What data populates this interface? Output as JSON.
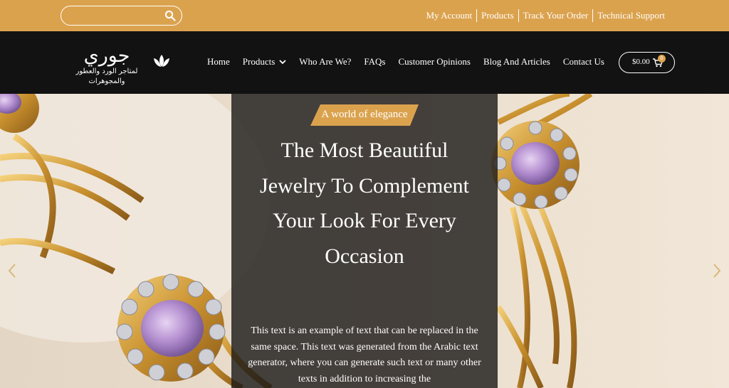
{
  "topbar": {
    "search": {
      "placeholder": "",
      "value": "",
      "icon": "search-icon"
    },
    "links": [
      "My Account",
      "Products",
      "Track Your Order",
      "Technical Support"
    ]
  },
  "header": {
    "logo": {
      "name": "جوري",
      "subtitle": "لمتاجر الورد والعطور والمجوهرات",
      "icon": "lotus-icon"
    },
    "nav": {
      "home": "Home",
      "products": "Products",
      "who": "Who Are We?",
      "faqs": "FAQs",
      "opinions": "Customer Opinions",
      "blog": "Blog And Articles",
      "contact": "Contact Us"
    },
    "cart": {
      "price": "$0.00",
      "count": "0",
      "icon": "basket-icon"
    }
  },
  "hero": {
    "tag": "A world of elegance",
    "headline": "The Most Beautiful Jewelry To Complement Your Look For Every Occasion",
    "body": "This text is an example of text that can be replaced in the same space. This text was generated from the Arabic text generator, where you can generate such text or many other texts in addition to increasing the",
    "prev_icon": "chevron-left-icon",
    "next_icon": "chevron-right-icon"
  },
  "colors": {
    "accent": "#DBA24E",
    "header_bg": "#121212",
    "panel_bg": "#1e1c1a"
  }
}
